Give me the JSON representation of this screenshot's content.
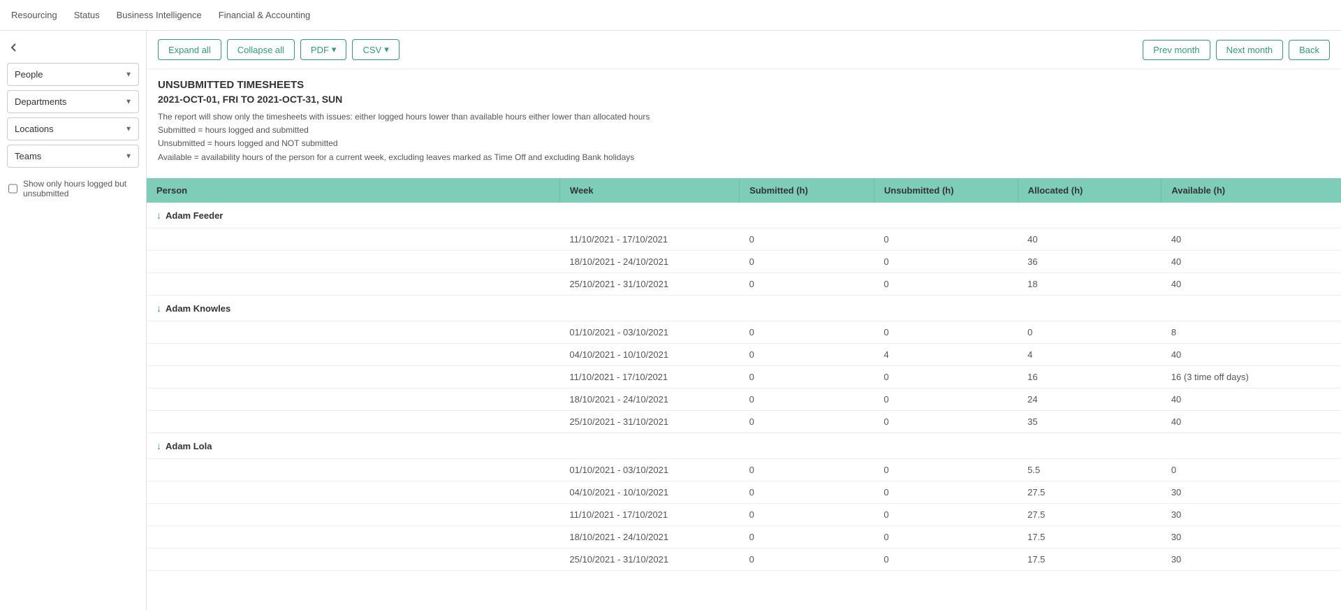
{
  "nav": {
    "items": [
      "Resourcing",
      "Status",
      "Business Intelligence",
      "Financial & Accounting"
    ]
  },
  "toolbar": {
    "expand_all": "Expand all",
    "collapse_all": "Collapse all",
    "pdf": "PDF",
    "csv": "CSV",
    "prev_month": "Prev month",
    "next_month": "Next month",
    "back": "Back"
  },
  "sidebar": {
    "back_icon": "←",
    "filters": [
      {
        "label": "People",
        "id": "people"
      },
      {
        "label": "Departments",
        "id": "departments"
      },
      {
        "label": "Locations",
        "id": "locations"
      },
      {
        "label": "Teams",
        "id": "teams"
      }
    ],
    "checkbox_label": "Show only hours logged but unsubmitted"
  },
  "report": {
    "title": "UNSUBMITTED TIMESHEETS",
    "date_range": "2021-OCT-01, FRI TO 2021-OCT-31, SUN",
    "description_lines": [
      "The report will show only the timesheets with issues: either logged hours lower than available hours either lower than allocated hours",
      "Submitted = hours logged and submitted",
      "Unsubmitted = hours logged and NOT submitted",
      "Available = availability hours of the person for a current week, excluding leaves marked as Time Off and excluding Bank holidays"
    ]
  },
  "table": {
    "headers": [
      "Person",
      "Week",
      "Submitted (h)",
      "Unsubmitted (h)",
      "Allocated (h)",
      "Available (h)"
    ],
    "people": [
      {
        "name": "Adam Feeder",
        "rows": [
          {
            "week": "11/10/2021 - 17/10/2021",
            "submitted": "0",
            "unsubmitted": "0",
            "allocated": "40",
            "available": "40"
          },
          {
            "week": "18/10/2021 - 24/10/2021",
            "submitted": "0",
            "unsubmitted": "0",
            "allocated": "36",
            "available": "40"
          },
          {
            "week": "25/10/2021 - 31/10/2021",
            "submitted": "0",
            "unsubmitted": "0",
            "allocated": "18",
            "available": "40"
          }
        ]
      },
      {
        "name": "Adam Knowles",
        "rows": [
          {
            "week": "01/10/2021 - 03/10/2021",
            "submitted": "0",
            "unsubmitted": "0",
            "allocated": "0",
            "available": "8"
          },
          {
            "week": "04/10/2021 - 10/10/2021",
            "submitted": "0",
            "unsubmitted": "4",
            "allocated": "4",
            "available": "40"
          },
          {
            "week": "11/10/2021 - 17/10/2021",
            "submitted": "0",
            "unsubmitted": "0",
            "allocated": "16",
            "available": "16 (3 time off days)"
          },
          {
            "week": "18/10/2021 - 24/10/2021",
            "submitted": "0",
            "unsubmitted": "0",
            "allocated": "24",
            "available": "40"
          },
          {
            "week": "25/10/2021 - 31/10/2021",
            "submitted": "0",
            "unsubmitted": "0",
            "allocated": "35",
            "available": "40"
          }
        ]
      },
      {
        "name": "Adam Lola",
        "rows": [
          {
            "week": "01/10/2021 - 03/10/2021",
            "submitted": "0",
            "unsubmitted": "0",
            "allocated": "5.5",
            "available": "0"
          },
          {
            "week": "04/10/2021 - 10/10/2021",
            "submitted": "0",
            "unsubmitted": "0",
            "allocated": "27.5",
            "available": "30"
          },
          {
            "week": "11/10/2021 - 17/10/2021",
            "submitted": "0",
            "unsubmitted": "0",
            "allocated": "27.5",
            "available": "30"
          },
          {
            "week": "18/10/2021 - 24/10/2021",
            "submitted": "0",
            "unsubmitted": "0",
            "allocated": "17.5",
            "available": "30"
          },
          {
            "week": "25/10/2021 - 31/10/2021",
            "submitted": "0",
            "unsubmitted": "0",
            "allocated": "17.5",
            "available": "30"
          }
        ]
      }
    ]
  }
}
